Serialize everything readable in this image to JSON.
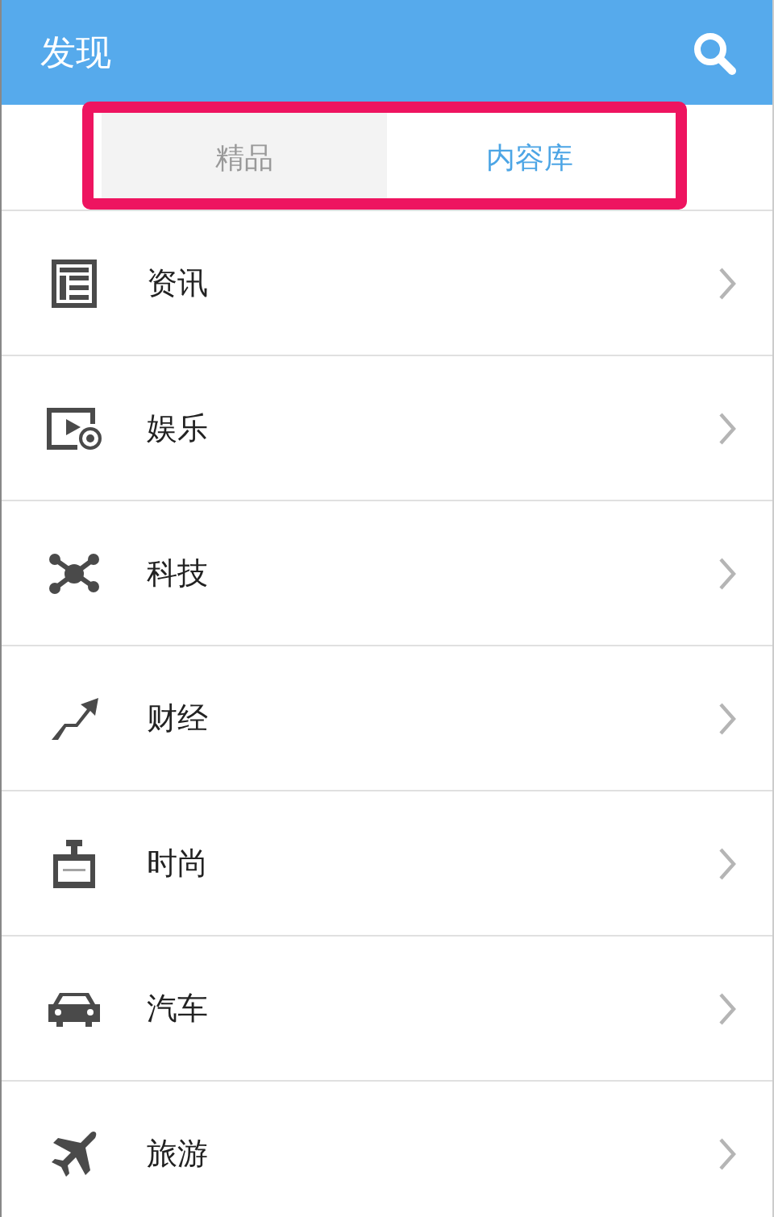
{
  "header": {
    "title": "发现"
  },
  "tabs": [
    {
      "label": "精品",
      "selected": false
    },
    {
      "label": "内容库",
      "selected": true
    }
  ],
  "categories": [
    {
      "label": "资讯",
      "kind": "news"
    },
    {
      "label": "娱乐",
      "kind": "video"
    },
    {
      "label": "科技",
      "kind": "network"
    },
    {
      "label": "财经",
      "kind": "trend"
    },
    {
      "label": "时尚",
      "kind": "perfume"
    },
    {
      "label": "汽车",
      "kind": "car"
    },
    {
      "label": "旅游",
      "kind": "plane"
    }
  ]
}
